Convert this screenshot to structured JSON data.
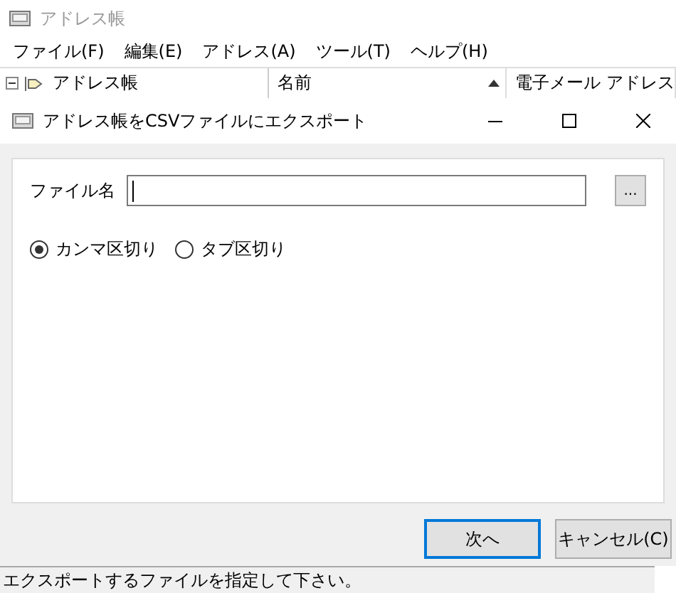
{
  "main_window": {
    "title": "アドレス帳"
  },
  "menu": [
    "ファイル(F)",
    "編集(E)",
    "アドレス(A)",
    "ツール(T)",
    "ヘルプ(H)"
  ],
  "tree": {
    "label": "アドレス帳",
    "expanded": true
  },
  "list": {
    "columns": [
      {
        "label": "名前",
        "sorted": true
      },
      {
        "label": "電子メール アドレス",
        "sorted": false
      }
    ]
  },
  "dialog": {
    "title": "アドレス帳をCSVファイルにエクスポート",
    "file_name_label": "ファイル名",
    "browse_button": "...",
    "delimiters": [
      {
        "label": "カンマ区切り",
        "selected": true
      },
      {
        "label": "タブ区切り",
        "selected": false
      }
    ],
    "buttons": [
      {
        "label": "次へ",
        "default": true
      },
      {
        "label": "キャンセル(C)",
        "default": false
      }
    ]
  },
  "status_bar": "エクスポートするファイルを指定して下さい。"
}
